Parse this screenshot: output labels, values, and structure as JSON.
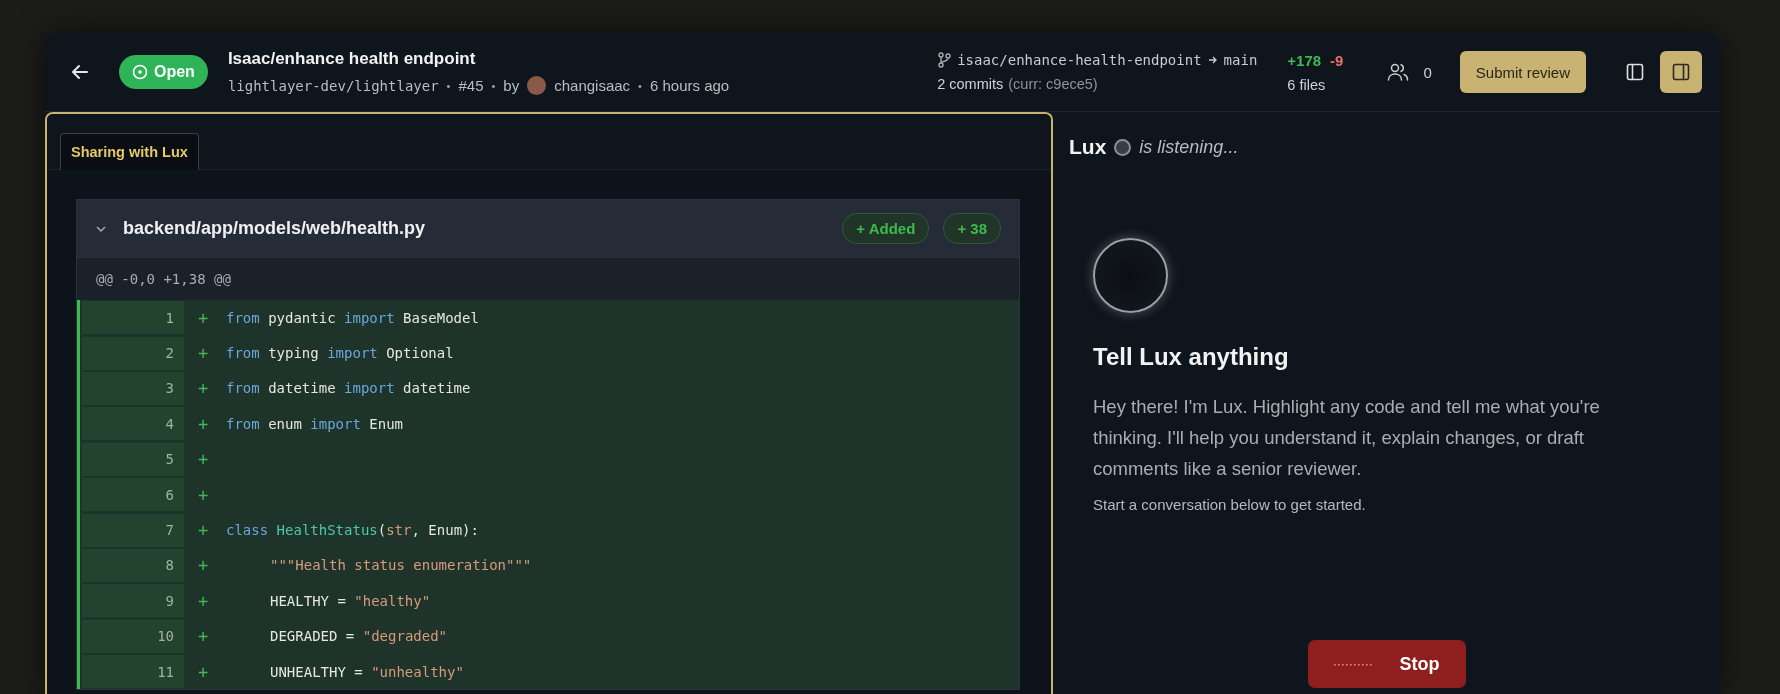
{
  "header": {
    "status": {
      "label": "Open",
      "kind": "open"
    },
    "title": "Isaac/enhance health endpoint",
    "meta": [
      {
        "kind": "repo",
        "text": "lightlayer-dev/lightlayer"
      },
      {
        "kind": "separator",
        "text": "•"
      },
      {
        "kind": "number",
        "text": "#45"
      },
      {
        "kind": "separator",
        "text": "•"
      },
      {
        "kind": "by",
        "text": "by"
      },
      {
        "kind": "author",
        "text": "changisaac"
      },
      {
        "kind": "separator",
        "text": "•"
      },
      {
        "kind": "time",
        "text": "6 hours ago"
      }
    ],
    "branch": {
      "source": "isaac/enhance-health-endpoint",
      "target": "main",
      "commits": "2 commits",
      "current": "(curr: c9ece5)"
    },
    "stats": {
      "additions": "+178",
      "deletions": "-9",
      "files": "6 files"
    },
    "reviewers": "0",
    "submit": "Submit review",
    "toggles": [
      {
        "kind": "left-panel",
        "selected": false
      },
      {
        "kind": "right-panel",
        "selected": true
      }
    ]
  },
  "share_tab": {
    "label": "Sharing with Lux",
    "selected": true
  },
  "file": {
    "path": "backend/app/models/web/health.py",
    "expanded": true,
    "status": "+ Added",
    "count": "+ 38",
    "hunk": "@@ -0,0 +1,38 @@",
    "lines": [
      {
        "number": "1",
        "sign": "+",
        "kind": "added",
        "tokens": [
          {
            "kind": "keyword",
            "text": "from"
          },
          {
            "kind": "text",
            "text": "pydantic"
          },
          {
            "kind": "keyword",
            "text": "import"
          },
          {
            "kind": "text",
            "text": "BaseModel"
          }
        ]
      },
      {
        "number": "2",
        "sign": "+",
        "kind": "added",
        "tokens": [
          {
            "kind": "keyword",
            "text": "from"
          },
          {
            "kind": "text",
            "text": "typing"
          },
          {
            "kind": "keyword",
            "text": "import"
          },
          {
            "kind": "text",
            "text": "Optional"
          }
        ]
      },
      {
        "number": "3",
        "sign": "+",
        "kind": "added",
        "tokens": [
          {
            "kind": "keyword",
            "text": "from"
          },
          {
            "kind": "text",
            "text": "datetime"
          },
          {
            "kind": "keyword",
            "text": "import"
          },
          {
            "kind": "text",
            "text": "datetime"
          }
        ]
      },
      {
        "number": "4",
        "sign": "+",
        "kind": "added",
        "tokens": [
          {
            "kind": "keyword",
            "text": "from"
          },
          {
            "kind": "text",
            "text": "enum"
          },
          {
            "kind": "keyword",
            "text": "import"
          },
          {
            "kind": "text",
            "text": "Enum"
          }
        ]
      },
      {
        "number": "5",
        "sign": "+",
        "kind": "added"
      },
      {
        "number": "6",
        "sign": "+",
        "kind": "added"
      },
      {
        "number": "7",
        "sign": "+",
        "kind": "added",
        "tokens": [
          {
            "kind": "keyword",
            "text": "class"
          },
          {
            "kind": "class",
            "text": "HealthStatus"
          },
          {
            "kind": "text",
            "text": "("
          },
          {
            "kind": "builtin",
            "text": "str"
          },
          {
            "kind": "text",
            "text": ", Enum):"
          }
        ]
      },
      {
        "number": "8",
        "sign": "+",
        "kind": "added",
        "indented": true,
        "tokens": [
          {
            "kind": "string",
            "text": "\"\"\"Health status enumeration\"\"\""
          }
        ]
      },
      {
        "number": "9",
        "sign": "+",
        "kind": "added",
        "indented": true,
        "tokens": [
          {
            "kind": "text",
            "text": "HEALTHY ="
          },
          {
            "kind": "string",
            "text": "\"healthy\""
          }
        ]
      },
      {
        "number": "10",
        "sign": "+",
        "kind": "added",
        "indented": true,
        "tokens": [
          {
            "kind": "text",
            "text": "DEGRADED ="
          },
          {
            "kind": "string",
            "text": "\"degraded\""
          }
        ]
      },
      {
        "number": "11",
        "sign": "+",
        "kind": "added",
        "indented": true,
        "tokens": [
          {
            "kind": "text",
            "text": "UNHEALTHY ="
          },
          {
            "kind": "string",
            "text": "\"unhealthy\""
          }
        ]
      }
    ]
  },
  "assistant": {
    "name": "Lux",
    "status": "is listening...",
    "listening": true,
    "heading": "Tell Lux anything",
    "intro": "Hey there! I'm Lux. Highlight any code and tell me what you're thinking. I'll help you understand it, explain changes, or draft comments like a senior reviewer.",
    "hint": "Start a conversation below to get started.",
    "stop": "Stop"
  }
}
